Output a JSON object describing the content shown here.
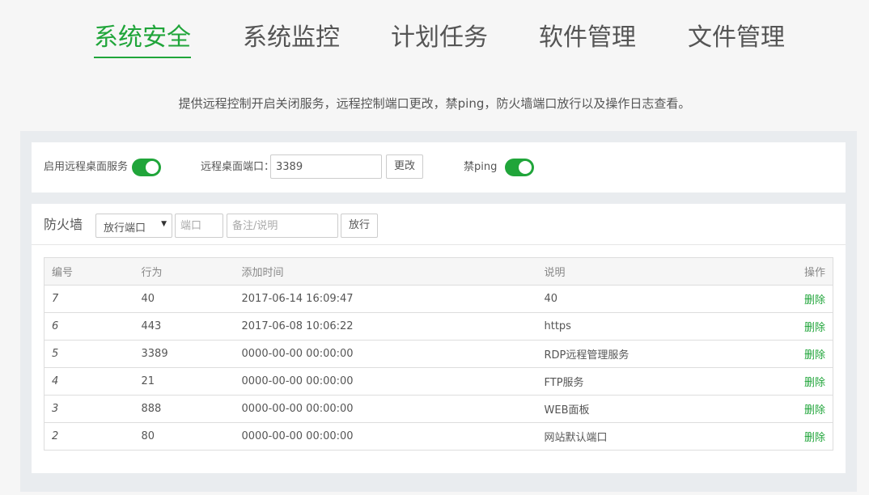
{
  "tabs": [
    {
      "label": "系统安全",
      "active": true
    },
    {
      "label": "系统监控",
      "active": false
    },
    {
      "label": "计划任务",
      "active": false
    },
    {
      "label": "软件管理",
      "active": false
    },
    {
      "label": "文件管理",
      "active": false
    }
  ],
  "description": "提供远程控制开启关闭服务，远程控制端口更改，禁ping，防火墙端口放行以及操作日志查看。",
  "remote": {
    "rdp_label": "启用远程桌面服务",
    "rdp_enabled": true,
    "port_label": "远程桌面端口：",
    "port_value": "3389",
    "change_label": "更改",
    "ping_label": "禁ping",
    "ping_enabled": true
  },
  "firewall": {
    "title": "防火墙",
    "select_value": "放行端口",
    "port_placeholder": "端口",
    "note_placeholder": "备注/说明",
    "submit_label": "放行",
    "columns": [
      "编号",
      "行为",
      "添加时间",
      "说明",
      "操作"
    ],
    "rows": [
      {
        "id": "7",
        "action": "40",
        "time": "2017-06-14 16:09:47",
        "note": "40",
        "op": "删除"
      },
      {
        "id": "6",
        "action": "443",
        "time": "2017-06-08 10:06:22",
        "note": "https",
        "op": "删除"
      },
      {
        "id": "5",
        "action": "3389",
        "time": "0000-00-00 00:00:00",
        "note": "RDP远程管理服务",
        "op": "删除"
      },
      {
        "id": "4",
        "action": "21",
        "time": "0000-00-00 00:00:00",
        "note": "FTP服务",
        "op": "删除"
      },
      {
        "id": "3",
        "action": "888",
        "time": "0000-00-00 00:00:00",
        "note": "WEB面板",
        "op": "删除"
      },
      {
        "id": "2",
        "action": "80",
        "time": "0000-00-00 00:00:00",
        "note": "网站默认端口",
        "op": "删除"
      }
    ]
  },
  "colors": {
    "accent": "#20a53a"
  }
}
